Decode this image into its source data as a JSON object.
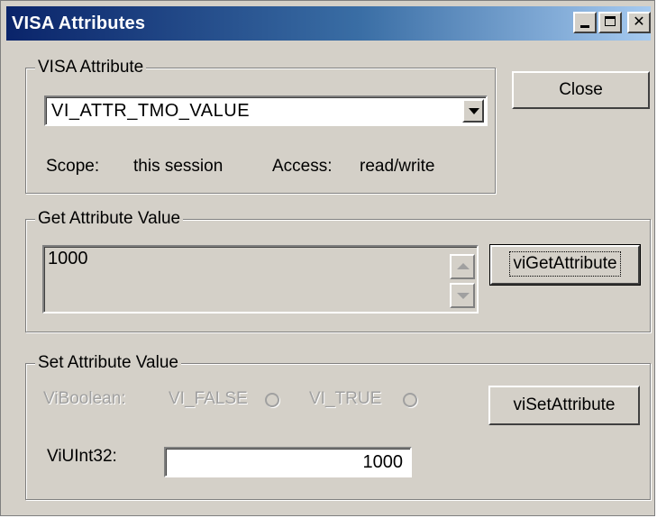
{
  "window": {
    "title": "VISA Attributes",
    "title_gradient_start": "#0a246a",
    "title_gradient_end": "#a6caf0",
    "face_color": "#d4d0c8",
    "minimize_label": "_",
    "close_label": "✕"
  },
  "attribute_group": {
    "label": "VISA Attribute",
    "selected_attribute": "VI_ATTR_TMO_VALUE",
    "scope_label": "Scope:",
    "scope_value": "this session",
    "access_label": "Access:",
    "access_value": "read/write"
  },
  "close_button": {
    "label": "Close"
  },
  "get_group": {
    "label": "Get Attribute Value",
    "value": "1000",
    "button_label": "viGetAttribute"
  },
  "set_group": {
    "label": "Set Attribute Value",
    "boolean_label": "ViBoolean:",
    "false_option": "VI_FALSE",
    "true_option": "VI_TRUE",
    "uint32_label": "ViUInt32:",
    "uint32_value": "1000",
    "button_label": "viSetAttribute"
  }
}
